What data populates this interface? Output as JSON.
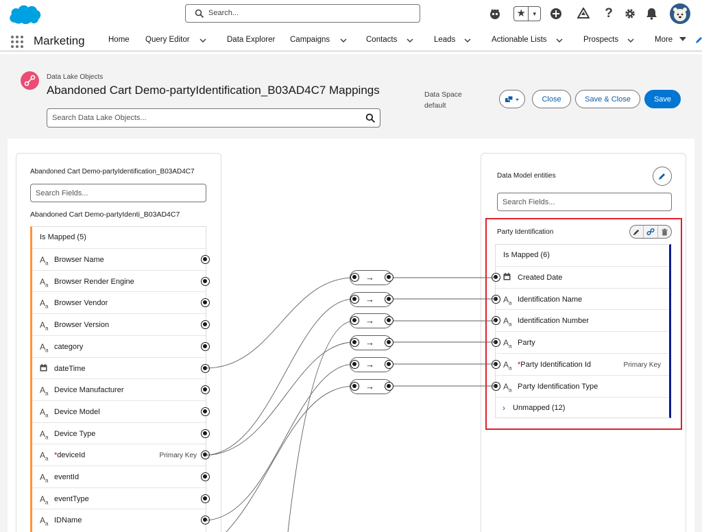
{
  "header": {
    "search_placeholder": "Search...",
    "icons": [
      "astro-icon",
      "favorites-star-icon",
      "global-add-icon",
      "trailhead-icon",
      "help-icon",
      "setup-gear-icon",
      "notifications-bell-icon",
      "user-avatar"
    ]
  },
  "nav": {
    "app_name": "Marketing",
    "items": [
      {
        "label": "Home",
        "has_menu": false
      },
      {
        "label": "Query Editor",
        "has_menu": true
      },
      {
        "label": "Data Explorer",
        "has_menu": false
      },
      {
        "label": "Campaigns",
        "has_menu": true
      },
      {
        "label": "Contacts",
        "has_menu": true
      },
      {
        "label": "Leads",
        "has_menu": true
      },
      {
        "label": "Actionable Lists",
        "has_menu": true
      },
      {
        "label": "Prospects",
        "has_menu": true
      },
      {
        "label": "More",
        "has_menu": true
      }
    ]
  },
  "page": {
    "object_type": "Data Lake Objects",
    "title": "Abandoned Cart Demo-partyIdentification_B03AD4C7 Mappings",
    "data_space_label": "Data Space",
    "data_space_value": "default",
    "lake_search_placeholder": "Search Data Lake Objects...",
    "buttons": {
      "close": "Close",
      "save_close": "Save & Close",
      "save": "Save"
    }
  },
  "left_panel": {
    "title": "Abandoned Cart Demo-partyIdentification_B03AD4C7",
    "search_placeholder": "Search Fields...",
    "object_name": "Abandoned Cart Demo-partyIdenti_B03AD4C7",
    "group_label": "Is Mapped (5)",
    "fields": [
      {
        "name": "Browser Name",
        "type": "text",
        "required": false,
        "primary_key": ""
      },
      {
        "name": "Browser Render Engine",
        "type": "text",
        "required": false,
        "primary_key": ""
      },
      {
        "name": "Browser Vendor",
        "type": "text",
        "required": false,
        "primary_key": ""
      },
      {
        "name": "Browser Version",
        "type": "text",
        "required": false,
        "primary_key": ""
      },
      {
        "name": "category",
        "type": "text",
        "required": false,
        "primary_key": ""
      },
      {
        "name": "dateTime",
        "type": "date",
        "required": false,
        "primary_key": ""
      },
      {
        "name": "Device Manufacturer",
        "type": "text",
        "required": false,
        "primary_key": ""
      },
      {
        "name": "Device Model",
        "type": "text",
        "required": false,
        "primary_key": ""
      },
      {
        "name": "Device Type",
        "type": "text",
        "required": false,
        "primary_key": ""
      },
      {
        "name": "deviceId",
        "type": "text",
        "required": true,
        "primary_key": "Primary Key"
      },
      {
        "name": "eventId",
        "type": "text",
        "required": false,
        "primary_key": ""
      },
      {
        "name": "eventType",
        "type": "text",
        "required": false,
        "primary_key": ""
      },
      {
        "name": "IDName",
        "type": "text",
        "required": false,
        "primary_key": ""
      }
    ]
  },
  "right_panel": {
    "title": "Data Model entities",
    "search_placeholder": "Search Fields...",
    "entity_name": "Party Identification",
    "group_label": "Is Mapped (6)",
    "fields": [
      {
        "name": "Created Date",
        "type": "date",
        "required": false,
        "primary_key": ""
      },
      {
        "name": "Identification Name",
        "type": "text",
        "required": false,
        "primary_key": ""
      },
      {
        "name": "Identification Number",
        "type": "text",
        "required": false,
        "primary_key": ""
      },
      {
        "name": "Party",
        "type": "text",
        "required": false,
        "primary_key": ""
      },
      {
        "name": "Party Identification Id",
        "type": "text",
        "required": true,
        "primary_key": "Primary Key"
      },
      {
        "name": "Party Identification Type",
        "type": "text",
        "required": false,
        "primary_key": ""
      }
    ],
    "unmapped_label": "Unmapped (12)"
  },
  "colors": {
    "brand_blue": "#0176d3",
    "mapped_accent_left": "#fe9339",
    "mapped_accent_right": "#061c8f",
    "highlight_red": "#e01e2a"
  }
}
